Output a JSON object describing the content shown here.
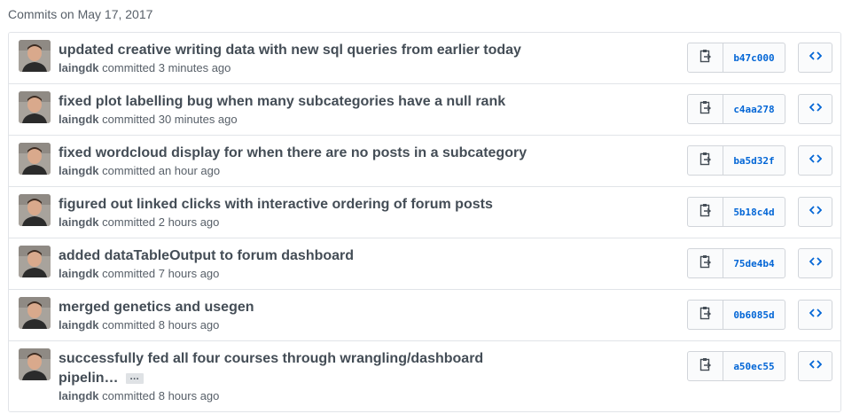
{
  "group_title": "Commits on May 17, 2017",
  "icons": {
    "copy": "clipboard-icon",
    "browse": "code-icon"
  },
  "colors": {
    "sha": "#0366d6",
    "border": "#e1e4e8",
    "message": "#444d56",
    "meta": "#586069"
  },
  "commits": [
    {
      "message": "updated creative writing data with new sql queries from earlier today",
      "author": "laingdk",
      "action": "committed",
      "time": "3 minutes ago",
      "sha": "b47c000"
    },
    {
      "message": "fixed plot labelling bug when many subcategories have a null rank",
      "author": "laingdk",
      "action": "committed",
      "time": "30 minutes ago",
      "sha": "c4aa278"
    },
    {
      "message": "fixed wordcloud display for when there are no posts in a subcategory",
      "author": "laingdk",
      "action": "committed",
      "time": "an hour ago",
      "sha": "ba5d32f"
    },
    {
      "message": "figured out linked clicks with interactive ordering of forum posts",
      "author": "laingdk",
      "action": "committed",
      "time": "2 hours ago",
      "sha": "5b18c4d"
    },
    {
      "message": "added dataTableOutput to forum dashboard",
      "author": "laingdk",
      "action": "committed",
      "time": "7 hours ago",
      "sha": "75de4b4"
    },
    {
      "message": "merged genetics and usegen",
      "author": "laingdk",
      "action": "committed",
      "time": "8 hours ago",
      "sha": "0b6085d"
    },
    {
      "message": "successfully fed all four courses through wrangling/dashboard pipelin…",
      "author": "laingdk",
      "action": "committed",
      "time": "8 hours ago",
      "sha": "a50ec55",
      "ellipsis": "…"
    }
  ]
}
